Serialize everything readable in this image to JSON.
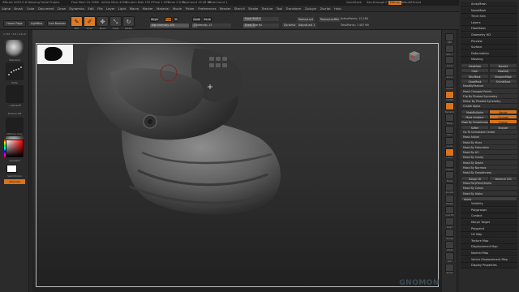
{
  "window": {
    "title": "ZBrush 2022.0.6 Wearing Facial Project",
    "free_mem": "Free Mem 12.52KB",
    "active_mem": "Active Mem 4256",
    "scratch_disk": "Scratch Disk 192",
    "ztime": "ZTime 1.922",
    "timer": "Timer 0.013",
    "poly_count": "PolyCount 15.28 KP",
    "mesh_count": "MeshCount 1",
    "quicksave": "QuickSave",
    "see_through": "See-through 0",
    "menus_label": "Menus",
    "default_zscript": "DefaultZScript"
  },
  "menubar": [
    "Alpha",
    "Brush",
    "Color",
    "Document",
    "Draw",
    "Dynamics",
    "Edit",
    "File",
    "Layer",
    "Light",
    "Macro",
    "Marker",
    "Material",
    "Movie",
    "Picker",
    "Preferences",
    "Render",
    "Stencil",
    "Stroke",
    "Texture",
    "Tool",
    "Transform",
    "Zplugin",
    "Zscript",
    "Help"
  ],
  "toolbar": {
    "tabs": [
      "Home Page",
      "LightBox",
      "Live Boolean"
    ],
    "icons": [
      {
        "label": "Edit",
        "icon": "edit-icon",
        "glyph": "✎",
        "active": true
      },
      {
        "label": "Draw",
        "icon": "draw-icon",
        "glyph": "✐",
        "active": true
      },
      {
        "label": "Move",
        "icon": "move-icon",
        "glyph": "✥",
        "active": false
      },
      {
        "label": "Scale",
        "icon": "scale-icon",
        "glyph": "⤡",
        "active": false
      },
      {
        "label": "Rotate",
        "icon": "rotate-icon",
        "glyph": "↻",
        "active": false
      }
    ],
    "mrgb": "Mrgb",
    "rgb": "Rgb",
    "m": "M",
    "zadd": "Zadd",
    "zsub": "Zsub",
    "rgb_intensity": "Rgb Intensity 100",
    "z_intensity": "Z Intensity 13",
    "focal_shift": "Focal Shift 0",
    "draw_size": "Draw Size 64",
    "dynamic": "Dynamic",
    "replay_last": "ReplayLast",
    "replay_last_rel": "ReplayLastRel",
    "active_points": "ActivePoints: 15,280",
    "total_points": "TotalPoints: 7.487 Mil",
    "adjust_last": "AdjustLast 1"
  },
  "left_panel": {
    "coords": "1.1ST / 2.8 / 4.6 UI",
    "items": [
      "Standard",
      "Dots",
      "~AlphaOff",
      "Texture Off",
      "MatCap Gray"
    ],
    "gradient_label": "Gradient",
    "switch_color": "SwitchColor",
    "alternate": "Alternate"
  },
  "right_shelf": [
    "BPR",
    "SPix 3",
    "Scroll",
    "Zoom",
    "Actual",
    "AAHalf",
    "Dynamic",
    "Persp",
    "Floor",
    "Local",
    "L.Sym",
    "Frame",
    "Move",
    "ZoomD",
    "Rotate",
    "Line Fill",
    "PolyF",
    "Transp",
    "Ghost",
    "Solo",
    "Xpose"
  ],
  "palette": {
    "heads": [
      "ArrayMesh",
      "NanoMesh",
      "Thick Skin",
      "Layers",
      "FiberMesh",
      "Geometry HD",
      "Preview",
      "Surface",
      "Deformation",
      "Masking"
    ],
    "masking": {
      "view_mask": "ViewMask",
      "mask_all": "MaskAll",
      "clear": "Clear",
      "mask_adj": "MaskAdj",
      "blur_mask": "BlurMask",
      "sharpen_mask": "SharpenMask",
      "grow_mask": "GrowMask",
      "shrink_mask": "ShrinkMask",
      "mask_by_feature": "MaskByFeature",
      "mask_changed": "Mask Changed Points",
      "flip_pivot": "Flip By Pivoted Symmetry",
      "mirror_pivot": "Mirror By Pivoted Symmetry",
      "create_alpha": "Create Alpha",
      "mask_by_alpha": "MaskByAlpha",
      "border": "Border",
      "mask_ambient": "Mask Ambient Occlusion",
      "occlusion": "Occlude",
      "crease": "Crease",
      "mask_by_smoothness": "Mask By Smoothness",
      "softer": "Softer",
      "sharper": "Sharper",
      "go_to_unmasked": "Go To Unmasked Center",
      "mask_adjust": "Mask Adjust",
      "mask_by_hue": "Mask By Hues",
      "mask_by_saturation": "Mask By Saturation",
      "mask_by_ao": "Mask By AO",
      "mask_by_cavity": "Mask By Cavity",
      "mask_by_depth": "Mask By Depth",
      "mask_by_normals": "Mask By Normals",
      "mask_by_smoothness2": "Mask By Smoothness",
      "range": "Range 18",
      "variance": "Variance 100",
      "mask_by_polypaint": "Mask PolyPaint/Alpha",
      "mask_by_colors": "Mask By Colors",
      "mask_by_alpha2": "Mask By Alpha",
      "apply": "Apply"
    },
    "tail_heads": [
      "Visibility",
      "Polygroups",
      "Contact",
      "Morph Target",
      "Polypaint",
      "UV Map",
      "Texture Map",
      "Displacement Map",
      "Normal Map",
      "Vector Displacement Map",
      "Display Properties"
    ]
  },
  "colors": {
    "accent": "#e07a1e",
    "panel": "#2a2a2a",
    "canvas_top": "#3a3a3a",
    "canvas_bottom": "#202020"
  }
}
